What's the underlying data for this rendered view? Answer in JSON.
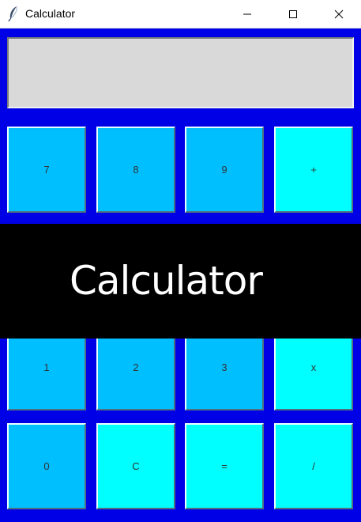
{
  "window": {
    "title": "Calculator",
    "icon": "feather-icon",
    "controls": [
      "minimize-icon",
      "maximize-icon",
      "close-icon"
    ]
  },
  "display": {
    "value": ""
  },
  "keys": {
    "row1": [
      "7",
      "8",
      "9",
      "+"
    ],
    "row3": [
      "1",
      "2",
      "3",
      "x"
    ],
    "row4": [
      "0",
      "C",
      "=",
      "/"
    ]
  },
  "banner": {
    "text": "Calculator"
  },
  "colors": {
    "background": "#0000e6",
    "number_key": "#00bfff",
    "operator_key": "#00ffff",
    "display": "#d9d9d9",
    "banner": "#000000",
    "banner_text": "#ffffff"
  }
}
